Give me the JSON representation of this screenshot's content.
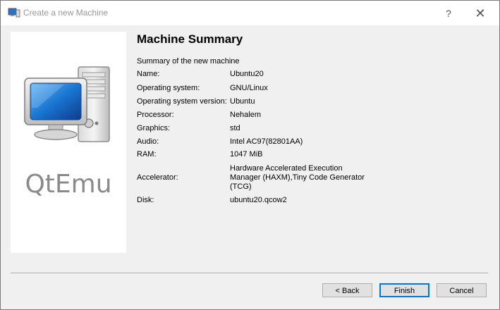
{
  "window": {
    "title": "Create a new Machine",
    "help_glyph": "?",
    "close_glyph": "✕"
  },
  "sidebar": {
    "logo_text": "QtEmu"
  },
  "summary": {
    "heading": "Machine Summary",
    "subtitle": "Summary of the new machine",
    "rows": [
      {
        "label": "Name:",
        "value": "Ubuntu20"
      },
      {
        "label": "Operating system:",
        "value": "GNU/Linux"
      },
      {
        "label": "Operating system version:",
        "value": "Ubuntu"
      },
      {
        "label": "Processor:",
        "value": "Nehalem"
      },
      {
        "label": "Graphics:",
        "value": "std"
      },
      {
        "label": "Audio:",
        "value": "Intel AC97(82801AA)"
      },
      {
        "label": "RAM:",
        "value": "1047 MiB"
      },
      {
        "label": "Accelerator:",
        "value": "Hardware Accelerated Execution Manager (HAXM),Tiny Code Generator (TCG)"
      },
      {
        "label": "Disk:",
        "value": "ubuntu20.qcow2"
      }
    ]
  },
  "buttons": {
    "back": "< Back",
    "finish": "Finish",
    "cancel": "Cancel"
  },
  "icons": {
    "title": "virtual-machine-icon",
    "sidebar": "computer-monitor-icon"
  },
  "colors": {
    "accent": "#0078d7",
    "screen_blue": "#1565c0"
  }
}
